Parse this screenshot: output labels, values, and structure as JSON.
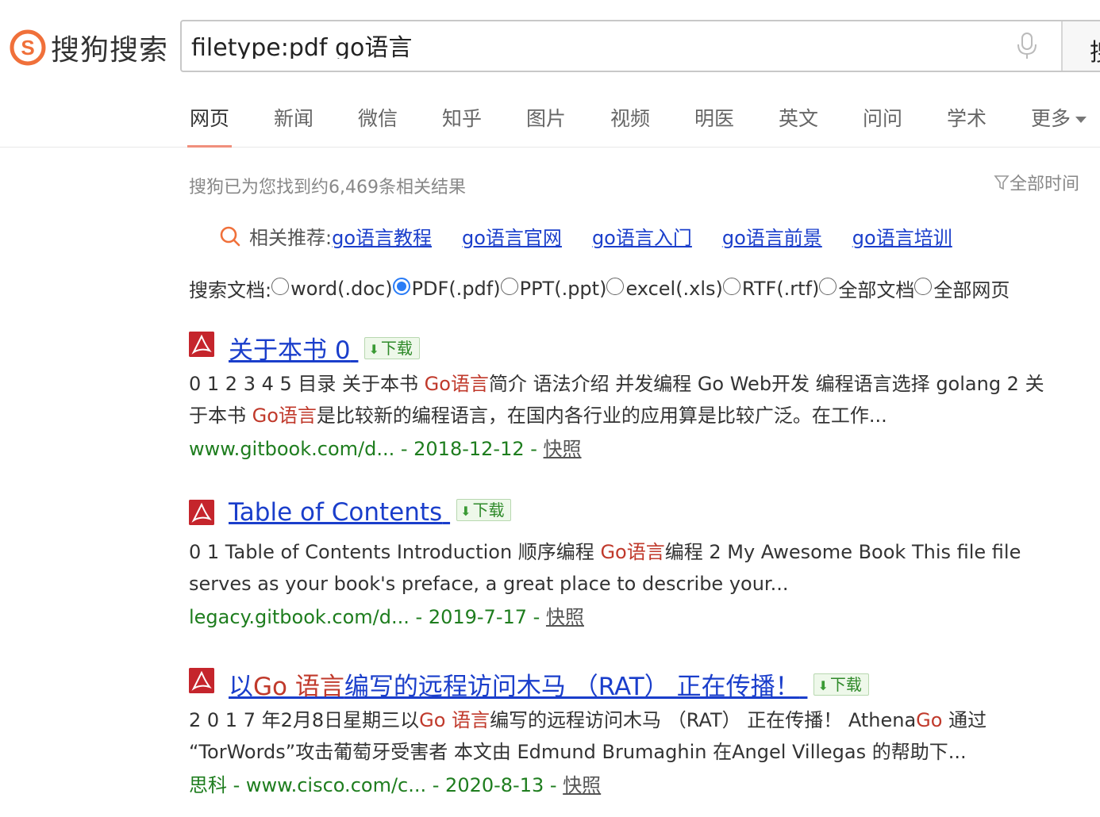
{
  "logo": {
    "text": "搜狗搜索"
  },
  "search": {
    "query": "filetype:pdf go语言",
    "button_label": "搜"
  },
  "tabs": [
    {
      "label": "网页",
      "active": true
    },
    {
      "label": "新闻"
    },
    {
      "label": "微信"
    },
    {
      "label": "知乎"
    },
    {
      "label": "图片"
    },
    {
      "label": "视频"
    },
    {
      "label": "明医"
    },
    {
      "label": "英文"
    },
    {
      "label": "问问"
    },
    {
      "label": "学术"
    },
    {
      "label": "更多"
    }
  ],
  "result_count": "搜狗已为您找到约6,469条相关结果",
  "time_filter": "全部时间",
  "related": {
    "label": "相关推荐:",
    "links": [
      "go语言教程",
      "go语言官网",
      "go语言入门",
      "go语言前景",
      "go语言培训"
    ]
  },
  "doc_filter": {
    "label": "搜索文档:",
    "options": [
      "word(.doc)",
      "PDF(.pdf)",
      "PPT(.ppt)",
      "excel(.xls)",
      "RTF(.rtf)",
      "全部文档",
      "全部网页"
    ],
    "selected": "PDF(.pdf)"
  },
  "download_label": "下载",
  "results": [
    {
      "title": "关于本书 0",
      "snippet_a": "0 1 2 3 4 5 目录 关于本书 ",
      "hl_a": "Go语言",
      "snippet_b": "简介 语法介绍 并发编程 Go Web开发 编程语言选择 golang 2 关于本书 ",
      "hl_b": "Go语言",
      "snippet_c": "是比较新的编程语言，在国内各行业的应用算是比较广泛。在工作...",
      "url": "www.gitbook.com/d...",
      "date": "2018-12-12",
      "snapshot": "快照"
    },
    {
      "title": "Table of Contents",
      "snippet_a": "0 1 Table of Contents Introduction 顺序编程 ",
      "hl_a": "Go语言",
      "snippet_b": "编程 2 My Awesome Book This file file serves as your book's preface, a great place to describe your...",
      "url": "legacy.gitbook.com/d...",
      "date": "2019-7-17",
      "snapshot": "快照"
    },
    {
      "title_pre": "以",
      "title_hl": "Go 语言",
      "title_post": "编写的远程访问木马 （RAT） 正在传播！",
      "snippet_a": "2 0 1 7 年2月8日星期三以",
      "hl_a": "Go 语言",
      "snippet_b": "编写的远程访问木马 （RAT） 正在传播！ Athena",
      "hl_b": "Go",
      "snippet_c": " 通过 “TorWords”攻击葡萄牙受害者 本文由 Edmund Brumaghin 在Angel Villegas 的帮助下...",
      "source": "思科",
      "url": "www.cisco.com/c...",
      "date": "2020-8-13",
      "snapshot": "快照"
    }
  ]
}
